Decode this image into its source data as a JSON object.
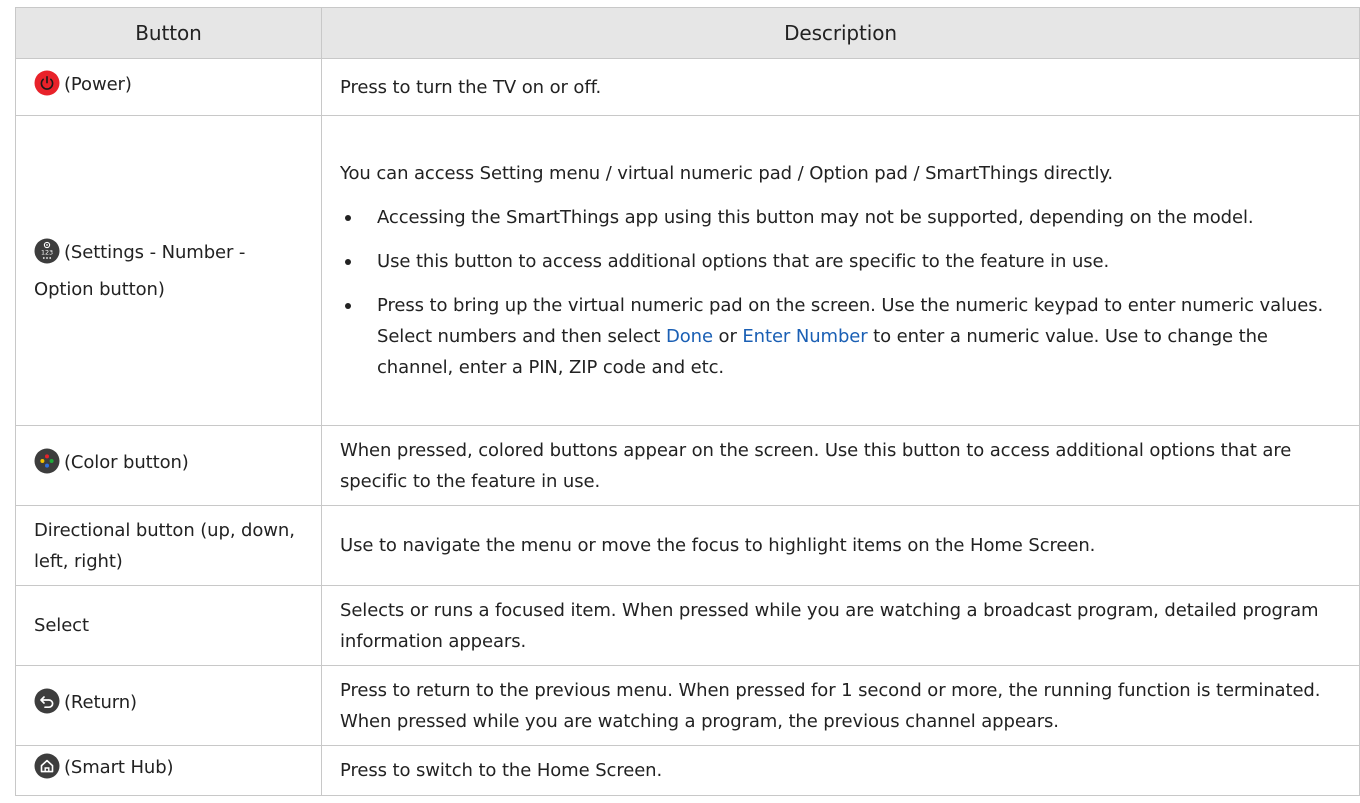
{
  "headers": {
    "button": "Button",
    "description": "Description"
  },
  "colors": {
    "power": "#e8222a",
    "icon_dark": "#3d3d3d",
    "link": "#1a5fb4"
  },
  "rows": [
    {
      "icon": "power-icon",
      "button": "(Power)",
      "description": "Press to turn the TV on or off."
    },
    {
      "icon": "settings-number-option-icon",
      "button": "(Settings - Number - Option button)",
      "intro": "You can access Setting menu / virtual numeric pad / Option pad / SmartThings directly.",
      "bullets": [
        "Accessing the SmartThings app using this button may not be supported, depending on the model.",
        "Use this button to access additional options that are specific to the feature in use."
      ],
      "bullet3": {
        "pre": "Press to bring up the virtual numeric pad on the screen. Use the numeric keypad to enter numeric values. Select numbers and then select ",
        "hl1": "Done",
        "mid": " or ",
        "hl2": "Enter Number",
        "post": " to enter a numeric value. Use to change the channel, enter a PIN, ZIP code and etc."
      }
    },
    {
      "icon": "color-button-icon",
      "button": "(Color button)",
      "description": "When pressed, colored buttons appear on the screen. Use this button to access additional options that are specific to the feature in use."
    },
    {
      "button": "Directional button (up, down, left, right)",
      "description": "Use to navigate the menu or move the focus to highlight items on the Home Screen."
    },
    {
      "button": "Select",
      "description": "Selects or runs a focused item. When pressed while you are watching a broadcast program, detailed program information appears."
    },
    {
      "icon": "return-icon",
      "button": "(Return)",
      "description": "Press to return to the previous menu. When pressed for 1 second or more, the running function is terminated. When pressed while you are watching a program, the previous channel appears."
    },
    {
      "icon": "home-icon",
      "button": "(Smart Hub)",
      "description": "Press to switch to the Home Screen."
    }
  ]
}
